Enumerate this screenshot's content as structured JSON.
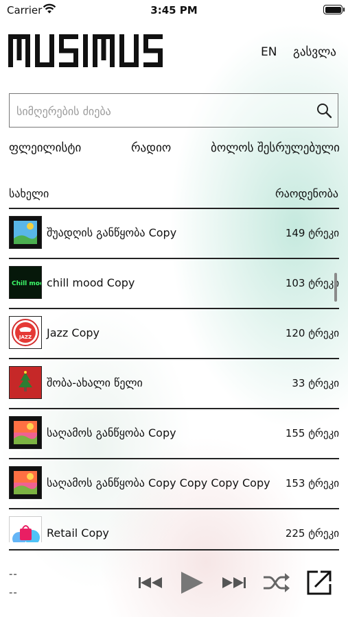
{
  "status_bar": {
    "carrier": "Carrier",
    "time": "3:45 PM"
  },
  "header": {
    "logo_text": "MUSIMUS",
    "language": "EN",
    "logout": "გასვლა"
  },
  "search": {
    "placeholder": "სიმღერების ძიება",
    "value": ""
  },
  "tabs": [
    {
      "label": "ფლეილისტი"
    },
    {
      "label": "რადიო"
    },
    {
      "label": "ბოლოს შესრულებული"
    }
  ],
  "columns": {
    "name": "სახელი",
    "count": "რაოდენობა"
  },
  "playlists": [
    {
      "title": "შუადღის განწყობა Copy",
      "count": "149 ტრეკი",
      "thumb": "landscape-day"
    },
    {
      "title": "chill mood Copy",
      "count": "103 ტრეკი",
      "thumb": "chill-neon",
      "thumb_text": "Chill mood"
    },
    {
      "title": "Jazz Copy",
      "count": "120 ტრეკი",
      "thumb": "jazz-logo",
      "thumb_text": "JAZZ"
    },
    {
      "title": "შობა-ახალი წელი",
      "count": "33 ტრეკი",
      "thumb": "christmas-tree"
    },
    {
      "title": "საღამოს განწყობა Copy",
      "count": "155 ტრეკი",
      "thumb": "landscape-sunset"
    },
    {
      "title": "საღამოს განწყობა Copy Copy Copy Copy",
      "count": "153 ტრეკი",
      "thumb": "landscape-sunset"
    },
    {
      "title": "Retail Copy",
      "count": "225 ტრეკი",
      "thumb": "shopping-bag"
    }
  ],
  "now_playing": {
    "title": "--",
    "artist": "--"
  },
  "colors": {
    "accent_glow": "#96d7c3",
    "line": "#222222"
  }
}
